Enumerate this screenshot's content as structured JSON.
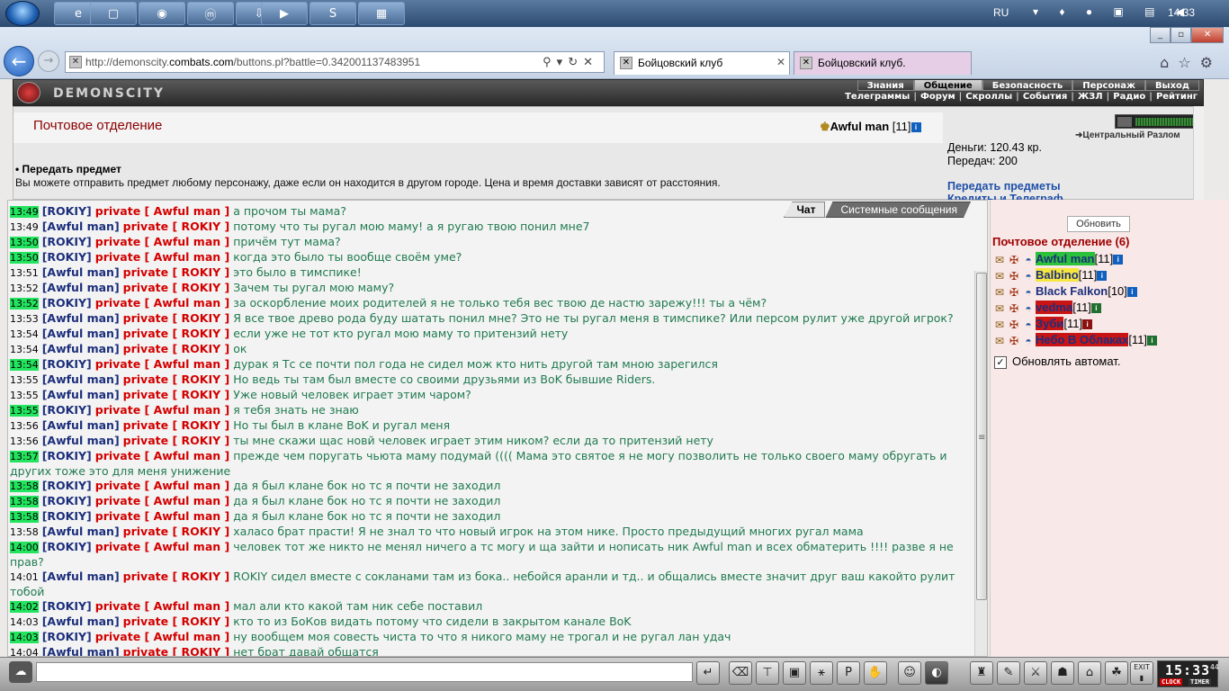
{
  "taskbar": {
    "lang": "RU",
    "clock": "14:33",
    "apps": [
      "e",
      "▢",
      "◉",
      "ⓜ",
      "⇩",
      "▶",
      "S",
      "▦"
    ]
  },
  "browser": {
    "url_prefix": "http://demonscity.",
    "url_domain": "combats.com",
    "url_rest": "/buttons.pl?battle=0.342001137483951",
    "tabs": [
      "Бойцовский клуб",
      "Бойцовский клуб."
    ]
  },
  "game": {
    "logo": "DEMONSCITY",
    "nav_top": [
      "Знания",
      "Общение",
      "Безопасность",
      "Персонаж",
      "Выход"
    ],
    "nav_top_active": 1,
    "nav_bottom": [
      "Телеграммы",
      "Форум",
      "Скроллы",
      "События",
      "ЖЗЛ",
      "Радио",
      "Рейтинг"
    ]
  },
  "header": {
    "title": "Почтовое отделение",
    "user_name": "Awful man",
    "user_level": "[11]",
    "location": "Центральный Разлом",
    "money": "Деньги: 120.43 кр.",
    "transfers": "Передач: 200",
    "transfer_link": "Передать предметы",
    "telegraph_link": "Кредиты и Телеграф",
    "section_head": "• Передать предмет",
    "section_desc": "Вы можете отправить предмет любому персонажу, даже если он находится в другом городе. Цена и время доставки зависят от расстояния."
  },
  "chat": {
    "tab_chat": "Чат",
    "tab_system": "Системные сообщения",
    "messages": [
      {
        "t": "13:49",
        "hl": true,
        "from": "[ROKIY]",
        "to": "private [ Awful man ]",
        "text": "а прочом ты мама?"
      },
      {
        "t": "13:49",
        "hl": false,
        "from": "[Awful man]",
        "to": "private [ ROKIY ]",
        "text": "потому что ты ругал мою маму! а я ругаю твою понил мне7"
      },
      {
        "t": "13:50",
        "hl": true,
        "from": "[ROKIY]",
        "to": "private [ Awful man ]",
        "text": "причём тут мама?"
      },
      {
        "t": "13:50",
        "hl": true,
        "from": "[ROKIY]",
        "to": "private [ Awful man ]",
        "text": "когда это было ты вообще своём уме?"
      },
      {
        "t": "13:51",
        "hl": false,
        "from": "[Awful man]",
        "to": "private [ ROKIY ]",
        "text": "это было в тимспике!"
      },
      {
        "t": "13:52",
        "hl": false,
        "from": "[Awful man]",
        "to": "private [ ROKIY ]",
        "text": "Зачем ты ругал мою маму?"
      },
      {
        "t": "13:52",
        "hl": true,
        "from": "[ROKIY]",
        "to": "private [ Awful man ]",
        "text": "за оскорбление моих родителей я не только тебя вес твою де настю зарежу!!! ты а чём?"
      },
      {
        "t": "13:53",
        "hl": false,
        "from": "[Awful man]",
        "to": "private [ ROKIY ]",
        "text": "Я все твое древо рода буду шатать понил мне? Это не ты ругал меня в тимспике? Или персом рулит уже другой игрок?"
      },
      {
        "t": "13:54",
        "hl": false,
        "from": "[Awful man]",
        "to": "private [ ROKIY ]",
        "text": "если уже не тот кто ругал мою маму то притензий нету"
      },
      {
        "t": "13:54",
        "hl": false,
        "from": "[Awful man]",
        "to": "private [ ROKIY ]",
        "text": "ок"
      },
      {
        "t": "13:54",
        "hl": true,
        "from": "[ROKIY]",
        "to": "private [ Awful man ]",
        "text": "дурак я Тс се почти пол года не сидел мож кто нить другой там мною зарегился"
      },
      {
        "t": "13:55",
        "hl": false,
        "from": "[Awful man]",
        "to": "private [ ROKIY ]",
        "text": "Но ведь ты там был вместе со своими друзьями из BoK бывшие Riders."
      },
      {
        "t": "13:55",
        "hl": false,
        "from": "[Awful man]",
        "to": "private [ ROKIY ]",
        "text": "Уже новый человек играет этим чаром?"
      },
      {
        "t": "13:55",
        "hl": true,
        "from": "[ROKIY]",
        "to": "private [ Awful man ]",
        "text": "я тебя знать не знаю"
      },
      {
        "t": "13:56",
        "hl": false,
        "from": "[Awful man]",
        "to": "private [ ROKIY ]",
        "text": "Но ты был в клане BoK и ругал меня"
      },
      {
        "t": "13:56",
        "hl": false,
        "from": "[Awful man]",
        "to": "private [ ROKIY ]",
        "text": "ты мне скажи щас новй человек играет этим ником? если да то притензий нету"
      },
      {
        "t": "13:57",
        "hl": true,
        "from": "[ROKIY]",
        "to": "private [ Awful man ]",
        "text": "прежде чем поругать чьюта маму подумай (((( Мама это святое я не могу позволить не только своего маму обругать и других тоже это для меня унижение"
      },
      {
        "t": "13:58",
        "hl": true,
        "from": "[ROKIY]",
        "to": "private [ Awful man ]",
        "text": "да я был клане бок но тс я почти не заходил"
      },
      {
        "t": "13:58",
        "hl": true,
        "from": "[ROKIY]",
        "to": "private [ Awful man ]",
        "text": "да я был клане бок но тс я почти не заходил"
      },
      {
        "t": "13:58",
        "hl": true,
        "from": "[ROKIY]",
        "to": "private [ Awful man ]",
        "text": "да я был клане бок но тс я почти не заходил"
      },
      {
        "t": "13:58",
        "hl": false,
        "from": "[Awful man]",
        "to": "private [ ROKIY ]",
        "text": "халасо брат прасти! Я не знал то что новый игрок на этом нике. Просто предыдущий многих ругал мама"
      },
      {
        "t": "14:00",
        "hl": true,
        "from": "[ROKIY]",
        "to": "private [ Awful man ]",
        "text": "человек тот же никто не менял ничего а тс могу и ща зайти и нописать ник Awful man и всех обматерить !!!! разве я не прав?"
      },
      {
        "t": "14:01",
        "hl": false,
        "from": "[Awful man]",
        "to": "private [ ROKIY ]",
        "text": "ROKIY сидел вместе с сокланами там из бока.. небойся аранли и тд.. и общались вместе значит друг ваш какойто рулит тобой"
      },
      {
        "t": "14:02",
        "hl": true,
        "from": "[ROKIY]",
        "to": "private [ Awful man ]",
        "text": "мал али кто какой там ник себе поставил"
      },
      {
        "t": "14:03",
        "hl": false,
        "from": "[Awful man]",
        "to": "private [ ROKIY ]",
        "text": "кто то из БоКов видать потому что сидели в закрытом канале BoK"
      },
      {
        "t": "14:03",
        "hl": true,
        "from": "[ROKIY]",
        "to": "private [ Awful man ]",
        "text": "ну вообщем моя совесть чиста то что я никого маму не трогал и не ругал лан удач"
      },
      {
        "t": "14:04",
        "hl": false,
        "from": "[Awful man]",
        "to": "private [ ROKIY ]",
        "text": "нет брат давай общатся"
      }
    ]
  },
  "sidebar": {
    "refresh": "Обновить",
    "title": "Почтовое отделение (6)",
    "auto_update": "Обновлять автомат.",
    "players": [
      {
        "name": "Awful man",
        "level": "[11]",
        "bg": "#2cc13a",
        "color": "#1c2f7c",
        "info": "blue"
      },
      {
        "name": "Balbino",
        "level": "[11]",
        "bg": "#f6e640",
        "color": "#1c2f7c",
        "info": "blue"
      },
      {
        "name": "Black Falkon",
        "level": "[10]",
        "bg": "",
        "color": "#1c2f7c",
        "info": "blue"
      },
      {
        "name": "vedma",
        "level": "[11]",
        "bg": "#c81414",
        "color": "#1c2f7c",
        "info": "green"
      },
      {
        "name": "Зуби",
        "level": "[11]",
        "bg": "#c81414",
        "color": "#1c2f7c",
        "info": "red"
      },
      {
        "name": "Небо В Облаках",
        "level": "[11]",
        "bg": "#c81414",
        "color": "#1c2f7c",
        "info": "green"
      }
    ]
  },
  "bottom": {
    "clock": "15:33",
    "clock_seconds": "44",
    "clock_label": "CLOCK",
    "timer_label": "TIMER",
    "exit_label": "EXIT"
  }
}
